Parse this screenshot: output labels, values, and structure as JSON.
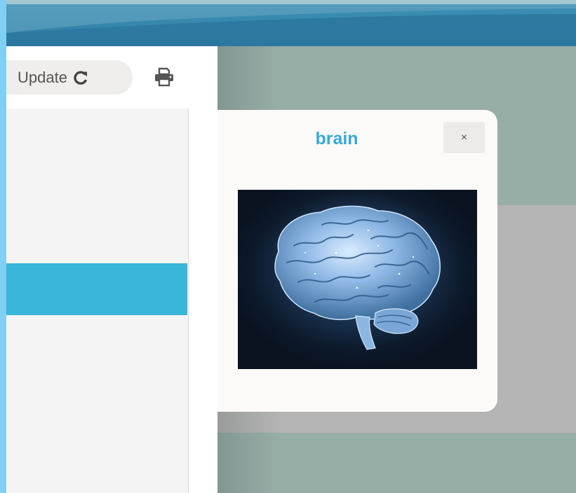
{
  "toolbar": {
    "update_label": "Update",
    "refresh_icon": "refresh-icon",
    "print_icon": "print-icon"
  },
  "modal": {
    "title": "brain",
    "close_label": "×",
    "image_alt": "brain"
  },
  "colors": {
    "accent": "#39b6d8",
    "title": "#3aa9d8",
    "banner": "#2f7ea4",
    "backdrop": "#97aea7"
  }
}
